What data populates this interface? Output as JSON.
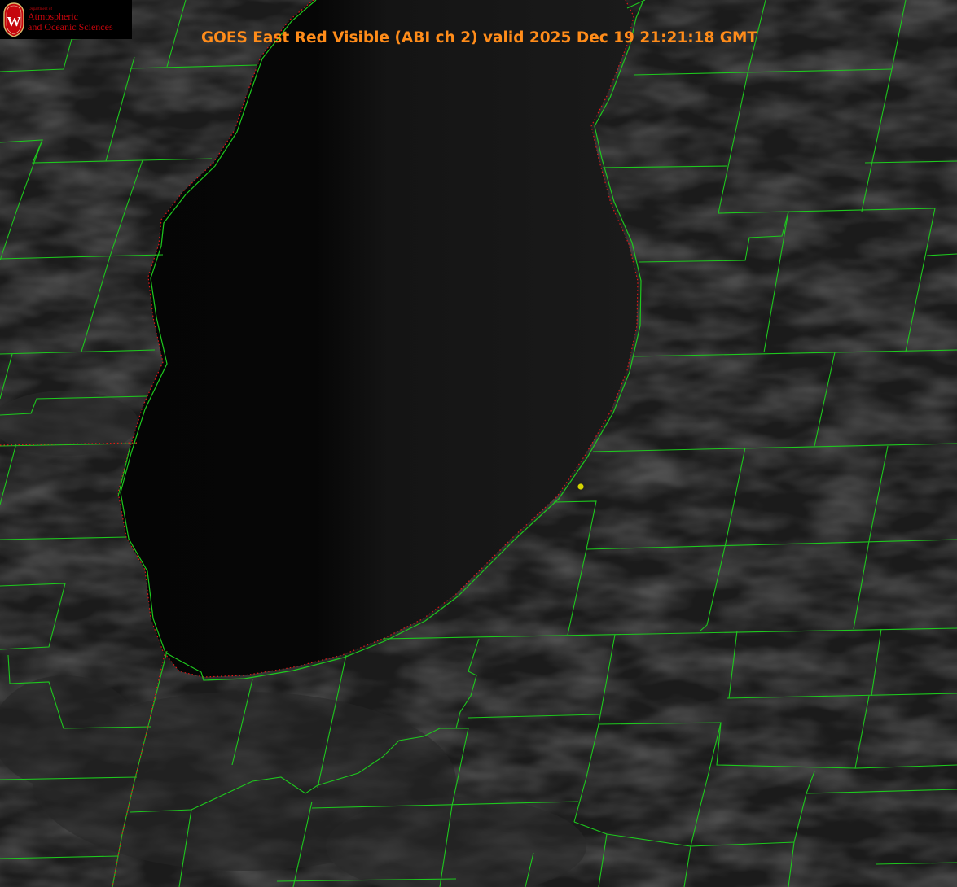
{
  "title": "GOES East Red Visible (ABI ch 2) valid 2025 Dec 19 21:21:18 GMT",
  "logo": {
    "department": "Department of",
    "line1": "Atmospheric",
    "line2": "and Oceanic Sciences",
    "crest_letter": "W"
  },
  "colors": {
    "county_lines": "#1ec81e",
    "lake_shoreline": "#e01818",
    "title": "#ff8c1a",
    "logo_text": "#c5050c",
    "site_marker": "#d4d400"
  }
}
